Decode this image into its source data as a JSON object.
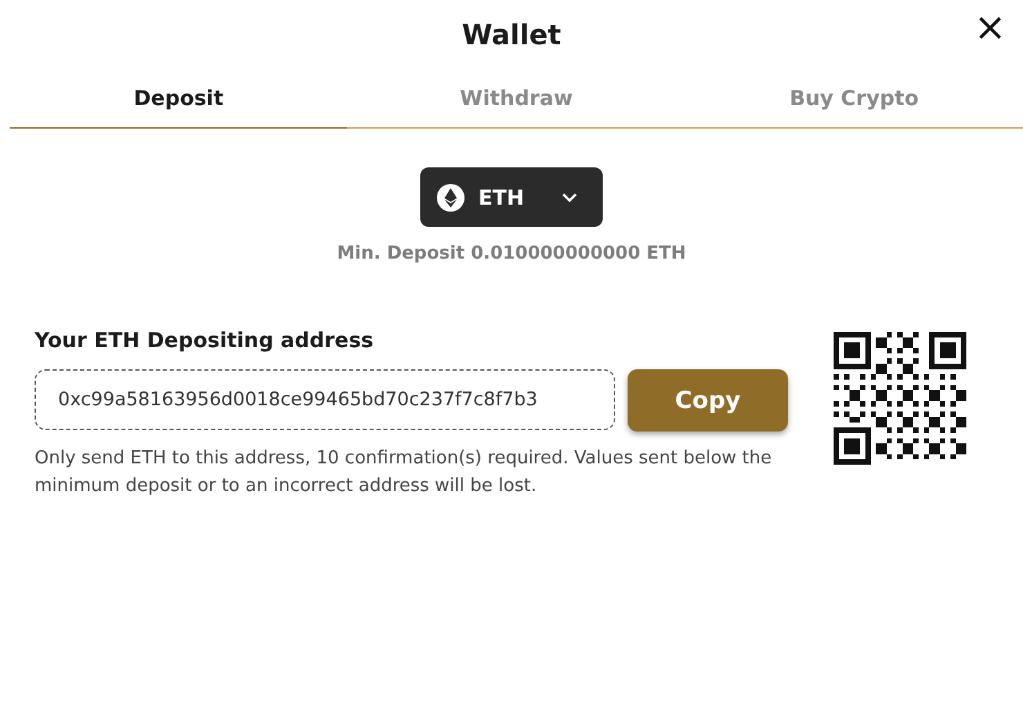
{
  "window": {
    "title": "Wallet",
    "close": "×"
  },
  "tabs": [
    {
      "label": "Deposit",
      "selected": true
    },
    {
      "label": "Withdraw",
      "selected": false
    },
    {
      "label": "Buy Crypto",
      "selected": false
    }
  ],
  "currency_select": {
    "value": "ETH"
  },
  "min_deposit": "Min. Deposit 0.010000000000 ETH",
  "address_label": "Your ETH Depositing address",
  "address_field": {
    "value": "0xc99a58163956d0018ce99465bd70c237f7c8f7b3"
  },
  "copy_button": "Copy",
  "note": "Only send ETH to this address, 10 confirmation(s) required. Values sent below the minimum deposit or to an incorrect address will be lost."
}
